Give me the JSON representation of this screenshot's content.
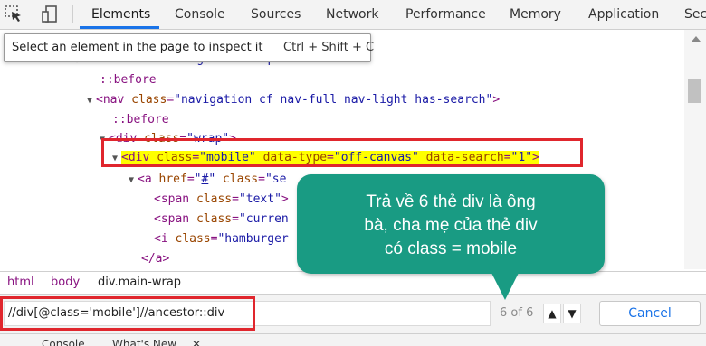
{
  "toolbar": {
    "inspect_icon": "inspect-cursor-icon",
    "device_icon": "device-toggle-icon",
    "tabs": [
      {
        "label": "Elements"
      },
      {
        "label": "Console"
      },
      {
        "label": "Sources"
      },
      {
        "label": "Network"
      },
      {
        "label": "Performance"
      },
      {
        "label": "Memory"
      },
      {
        "label": "Application"
      },
      {
        "label": "Sec"
      }
    ],
    "accent_color": "#1a73e8"
  },
  "tooltip": {
    "text": "Select an element in the page to inspect it",
    "shortcut": "Ctrl + Shift + C"
  },
  "tree": {
    "line0": {
      "prefix": "<",
      "tag": "div",
      "attr": "class",
      "value": "\"navigation-wrap cf\"",
      "suffix": ">"
    },
    "line1": "::before",
    "line2": {
      "tag": "nav",
      "attr": "class",
      "value": "\"navigation cf nav-full nav-light has-search\""
    },
    "line3": "::before",
    "line4": {
      "tag": "div",
      "attr": "class",
      "value": "\"wrap\""
    },
    "line5": {
      "tag": "div",
      "attr1": "class",
      "value1": "\"mobile\"",
      "attr2": "data-type",
      "value2": "\"off-canvas\"",
      "attr3": "data-search",
      "value3": "\"1\""
    },
    "line6": {
      "tag": "a",
      "attr1": "href",
      "value1": "#",
      "attr2": "class",
      "value2": "\"se"
    },
    "line7": {
      "tag": "span",
      "attr": "class",
      "value": "\"text\""
    },
    "line8": {
      "tag": "span",
      "attr": "class",
      "value": "\"curren"
    },
    "line9": {
      "tag": "i",
      "attr": "class",
      "value": "\"hamburger"
    },
    "line10": "</a>",
    "highlight_color": "#ffff00"
  },
  "callout": {
    "line1": "Trả về 6 thẻ div là ông",
    "line2": "bà, cha mẹ của thẻ div",
    "line3": "có class = mobile",
    "color": "#199b83"
  },
  "breadcrumb": {
    "items": [
      "html",
      "body",
      "div.main-wrap"
    ]
  },
  "search": {
    "value": "//div[@class='mobile']//ancestor::div",
    "match_count": "6 of 6",
    "prev_icon": "chevron-up-icon",
    "next_icon": "chevron-down-icon",
    "cancel_label": "Cancel"
  },
  "drawer": {
    "tabs": [
      "Console",
      "What's New"
    ],
    "close_glyph": "✕"
  },
  "annotation_color": "#e0262d"
}
